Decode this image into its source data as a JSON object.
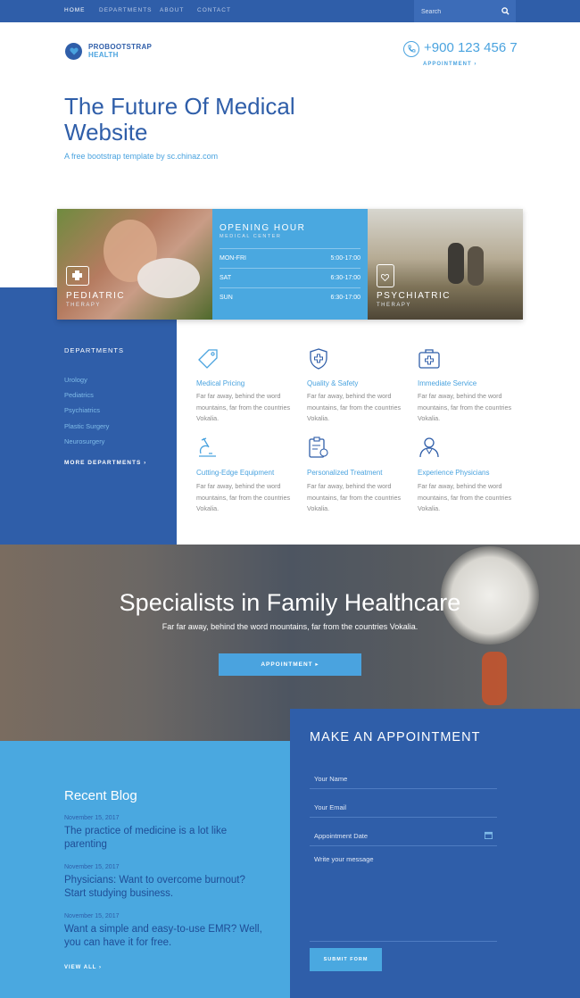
{
  "nav": {
    "items": [
      {
        "label": "HOME",
        "active": true
      },
      {
        "label": "DEPARTMENTS",
        "active": false
      },
      {
        "label": "ABOUT",
        "active": false
      },
      {
        "label": "CONTACT",
        "active": false
      }
    ],
    "search_placeholder": "Search",
    "search_icon": "search-icon"
  },
  "brand": {
    "line1": "PROBOOTSTRAP",
    "line2": "HEALTH",
    "icon": "heart-icon"
  },
  "contact": {
    "phone": "+900 123 456 7",
    "appointment_link": "APPOINTMENT ›",
    "icon": "phone-icon"
  },
  "hero": {
    "title": "The Future Of Medical Website",
    "subtitle": "A free bootstrap template by sc.chinaz.com"
  },
  "cards": {
    "pediatric": {
      "title": "PEDIATRIC",
      "sub": "THERAPY",
      "icon": "medical-kit-icon"
    },
    "hours": {
      "title": "OPENING HOUR",
      "sub": "MEDICAL CENTER",
      "rows": [
        {
          "day": "MON-FRI",
          "time": "5:00-17:00"
        },
        {
          "day": "SAT",
          "time": "6:30-17:00"
        },
        {
          "day": "SUN",
          "time": "6:30-17:00"
        }
      ]
    },
    "psychiatric": {
      "title": "PSYCHIATRIC",
      "sub": "THERAPY",
      "icon": "clipboard-heart-icon"
    }
  },
  "departments": {
    "heading": "DEPARTMENTS",
    "items": [
      "Urology",
      "Pediatrics",
      "Psychiatrics",
      "Plastic Surgery",
      "Neurosurgery"
    ],
    "more": "MORE DEPARTMENTS ›"
  },
  "services": [
    {
      "title": "Medical Pricing",
      "text": "Far far away, behind the word mountains, far from the countries Vokalia.",
      "icon": "price-tag-icon"
    },
    {
      "title": "Quality & Safety",
      "text": "Far far away, behind the word mountains, far from the countries Vokalia.",
      "icon": "shield-icon"
    },
    {
      "title": "Immediate Service",
      "text": "Far far away, behind the word mountains, far from the countries Vokalia.",
      "icon": "first-aid-kit-icon"
    },
    {
      "title": "Cutting-Edge Equipment",
      "text": "Far far away, behind the word mountains, far from the countries Vokalia.",
      "icon": "microscope-icon"
    },
    {
      "title": "Personalized Treatment",
      "text": "Far far away, behind the word mountains, far from the countries Vokalia.",
      "icon": "clipboard-icon"
    },
    {
      "title": "Experience Physicians",
      "text": "Far far away, behind the word mountains, far from the countries Vokalia.",
      "icon": "doctor-icon"
    }
  ],
  "specialists": {
    "title": "Specialists in Family Healthcare",
    "subtitle": "Far far away, behind the word mountains, far from the countries Vokalia.",
    "button": "APPOINTMENT ▸"
  },
  "blog": {
    "heading": "Recent Blog",
    "posts": [
      {
        "date": "November 15, 2017",
        "title": "The practice of medicine is a lot like parenting"
      },
      {
        "date": "November 15, 2017",
        "title": "Physicians: Want to overcome burnout? Start studying business."
      },
      {
        "date": "November 15, 2017",
        "title": "Want a simple and easy-to-use EMR? Well, you can have it for free."
      }
    ],
    "view_all": "VIEW ALL ›"
  },
  "appointment": {
    "heading": "MAKE AN APPOINTMENT",
    "name_placeholder": "Your Name",
    "email_placeholder": "Your Email",
    "date_placeholder": "Appointment Date",
    "message_placeholder": "Write your message",
    "submit": "SUBMIT FORM",
    "date_icon": "calendar-icon"
  },
  "colors": {
    "primary": "#2f5ea9",
    "accent": "#4aa3df",
    "light_blue": "#4aa8e0"
  }
}
